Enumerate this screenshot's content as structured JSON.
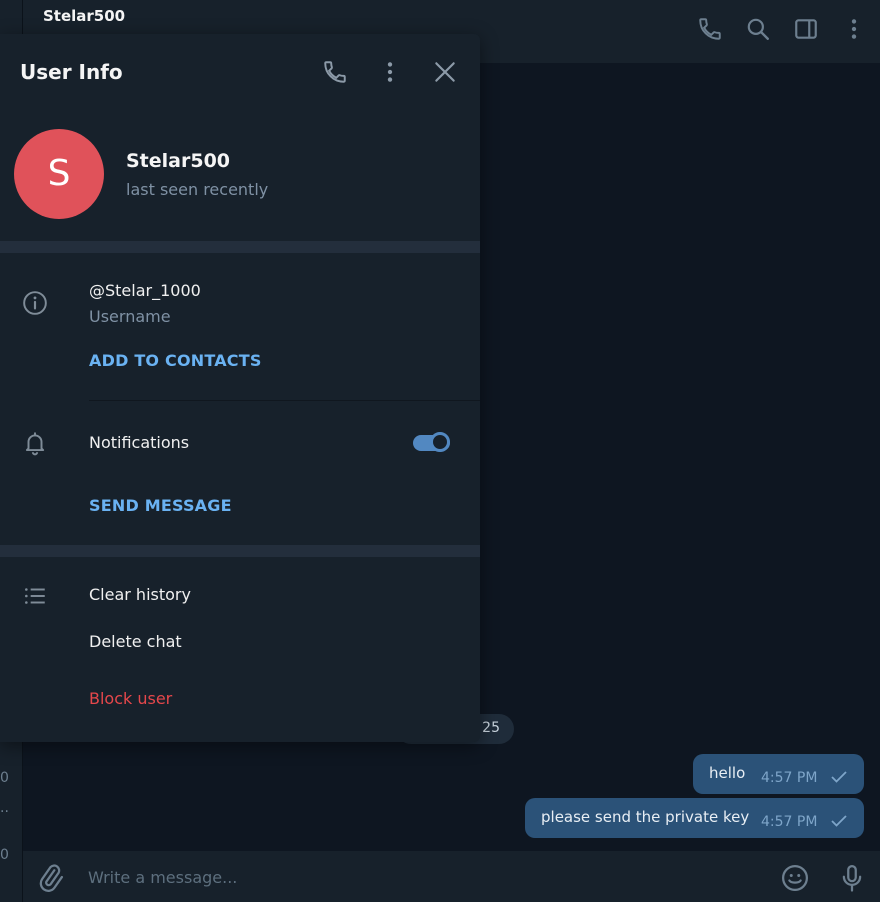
{
  "chat_list": {
    "fragments": [
      "0",
      "..",
      "0"
    ]
  },
  "chat_header": {
    "title": "Stelar500",
    "icons": [
      "phone-icon",
      "search-icon",
      "sidebar-toggle-icon",
      "more-vert-icon"
    ]
  },
  "messages": {
    "date_pill_text": "25",
    "items": [
      {
        "text": "hello",
        "time": "4:57 PM",
        "status": "sent"
      },
      {
        "text": "please send the private key",
        "time": "4:57 PM",
        "status": "sent"
      }
    ]
  },
  "composer": {
    "placeholder": "Write a message..."
  },
  "user_info": {
    "title": "User Info",
    "avatar_letter": "S",
    "avatar_color": "#e0525a",
    "name": "Stelar500",
    "status": "last seen recently",
    "username": "@Stelar_1000",
    "username_label": "Username",
    "add_to_contacts": "ADD TO CONTACTS",
    "notifications_label": "Notifications",
    "notifications_on": true,
    "send_message": "SEND MESSAGE",
    "clear_history": "Clear history",
    "delete_chat": "Delete chat",
    "block_user": "Block user"
  },
  "colors": {
    "accent": "#5288c1",
    "link": "#6ab2f2",
    "danger": "#e5474b",
    "bubble_out": "#2b5278"
  }
}
